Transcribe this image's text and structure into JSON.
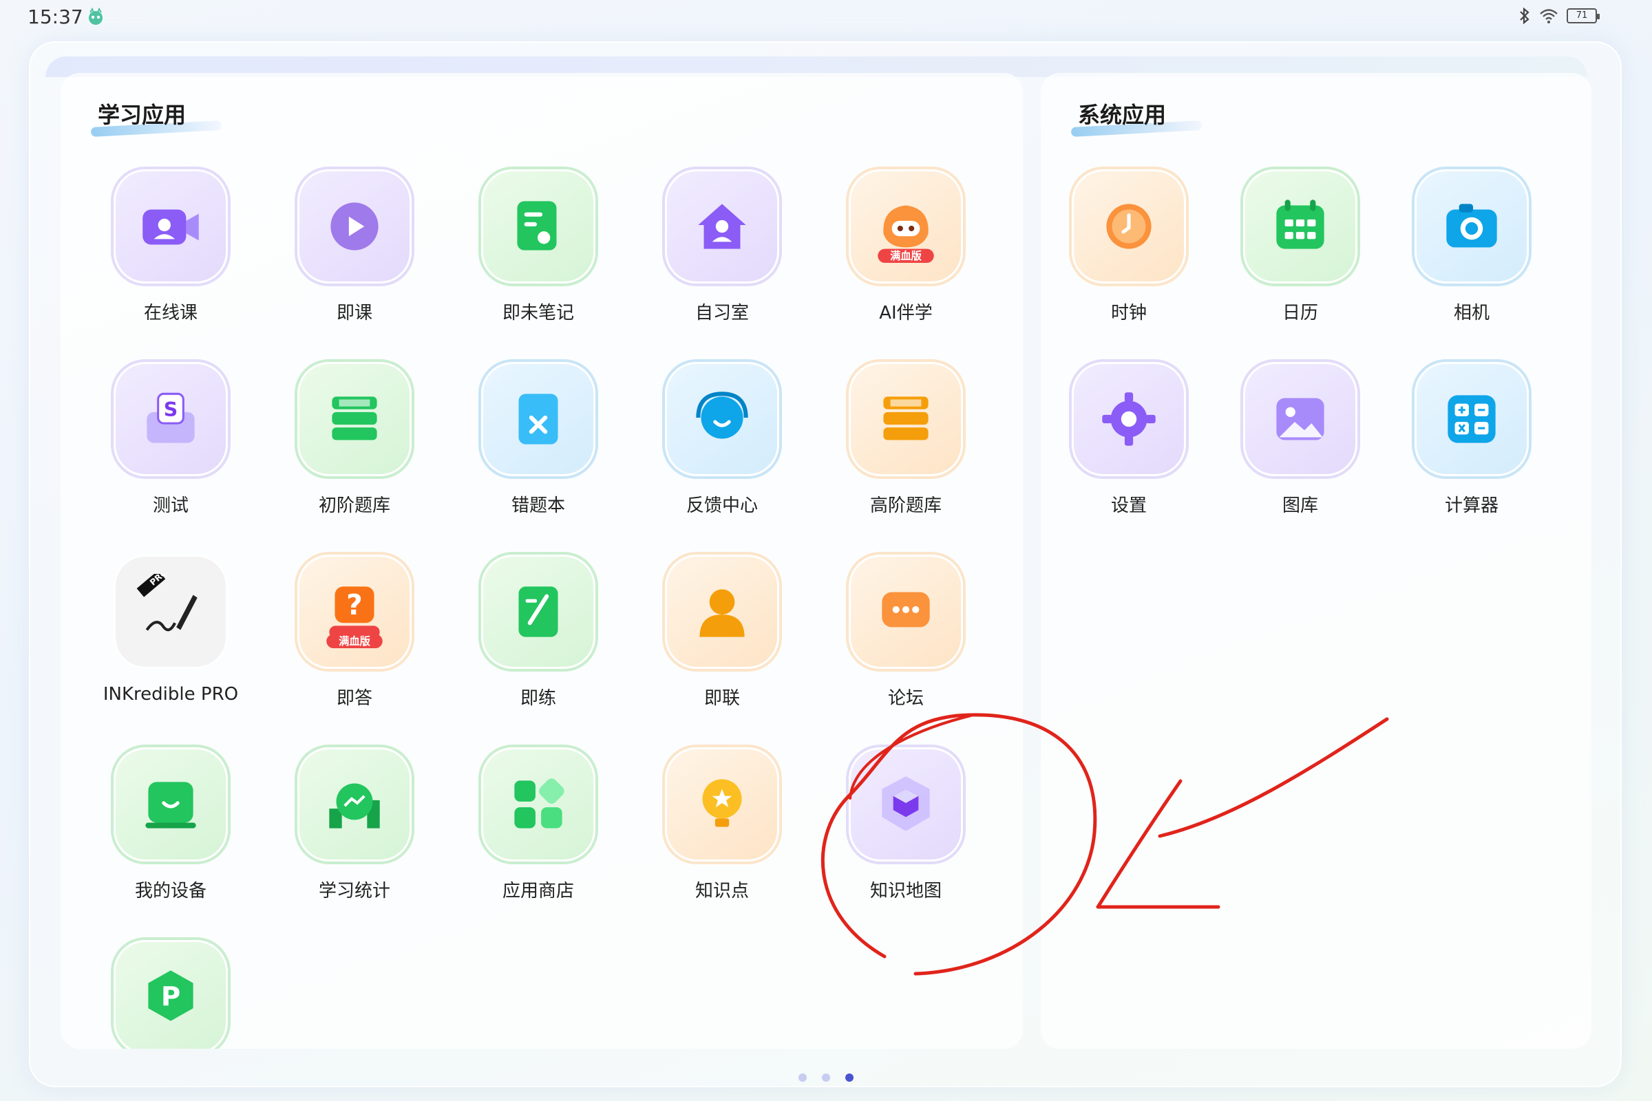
{
  "status_bar": {
    "time": "15:37",
    "battery": "71"
  },
  "learning_apps": {
    "title": "学习应用",
    "apps": [
      {
        "label": "在线课",
        "icon": "video-class-icon",
        "tint": "purple"
      },
      {
        "label": "即课",
        "icon": "play-bubble-icon",
        "tint": "purple"
      },
      {
        "label": "即未笔记",
        "icon": "note-document-icon",
        "tint": "green"
      },
      {
        "label": "自习室",
        "icon": "study-house-icon",
        "tint": "purple"
      },
      {
        "label": "AI伴学",
        "icon": "ai-mascot-icon",
        "tint": "orange",
        "badge": "满血版"
      },
      {
        "label": "测试",
        "icon": "test-envelope-icon",
        "tint": "purple"
      },
      {
        "label": "初阶题库",
        "icon": "book-stack-icon",
        "tint": "green"
      },
      {
        "label": "错题本",
        "icon": "error-notebook-icon",
        "tint": "blue"
      },
      {
        "label": "反馈中心",
        "icon": "headset-feedback-icon",
        "tint": "blue"
      },
      {
        "label": "高阶题库",
        "icon": "book-stack-icon",
        "tint": "orange"
      },
      {
        "label": "INKredible PRO",
        "icon": "pen-signature-icon",
        "tint": "gray",
        "badge": "PRO"
      },
      {
        "label": "即答",
        "icon": "question-bubble-icon",
        "tint": "orange",
        "badge": "满血版"
      },
      {
        "label": "即练",
        "icon": "practice-notebook-icon",
        "tint": "green"
      },
      {
        "label": "即联",
        "icon": "person-contact-icon",
        "tint": "orange"
      },
      {
        "label": "论坛",
        "icon": "forum-chat-icon",
        "tint": "orange"
      },
      {
        "label": "我的设备",
        "icon": "device-smile-icon",
        "tint": "green"
      },
      {
        "label": "学习统计",
        "icon": "stats-chart-icon",
        "tint": "green"
      },
      {
        "label": "应用商店",
        "icon": "app-store-grid-icon",
        "tint": "green"
      },
      {
        "label": "知识点",
        "icon": "bulb-star-icon",
        "tint": "orange"
      },
      {
        "label": "知识地图",
        "icon": "hexagon-cube-icon",
        "tint": "purple"
      },
      {
        "label": "",
        "icon": "p-hexagon-icon",
        "tint": "green"
      }
    ]
  },
  "system_apps": {
    "title": "系统应用",
    "apps": [
      {
        "label": "时钟",
        "icon": "clock-icon",
        "tint": "orange"
      },
      {
        "label": "日历",
        "icon": "calendar-icon",
        "tint": "green"
      },
      {
        "label": "相机",
        "icon": "camera-icon",
        "tint": "blue"
      },
      {
        "label": "设置",
        "icon": "gear-icon",
        "tint": "purple"
      },
      {
        "label": "图库",
        "icon": "gallery-icon",
        "tint": "purple"
      },
      {
        "label": "计算器",
        "icon": "calculator-icon",
        "tint": "blue"
      }
    ]
  },
  "pagination": {
    "pages": 3,
    "active": 3
  },
  "colors": {
    "annotation_red": "#e0241b",
    "purple": "#8b5cf6",
    "green": "#22c55e",
    "blue": "#0ea5e9",
    "orange": "#f59e0b",
    "active_dot": "#4a54d1"
  }
}
